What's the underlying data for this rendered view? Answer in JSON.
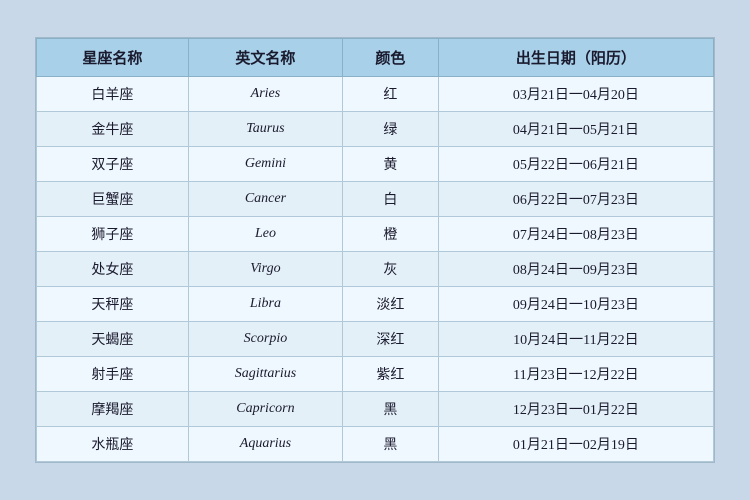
{
  "table": {
    "headers": [
      "星座名称",
      "英文名称",
      "颜色",
      "出生日期（阳历）"
    ],
    "rows": [
      {
        "zh": "白羊座",
        "en": "Aries",
        "color": "红",
        "dates": "03月21日一04月20日"
      },
      {
        "zh": "金牛座",
        "en": "Taurus",
        "color": "绿",
        "dates": "04月21日一05月21日"
      },
      {
        "zh": "双子座",
        "en": "Gemini",
        "color": "黄",
        "dates": "05月22日一06月21日"
      },
      {
        "zh": "巨蟹座",
        "en": "Cancer",
        "color": "白",
        "dates": "06月22日一07月23日"
      },
      {
        "zh": "狮子座",
        "en": "Leo",
        "color": "橙",
        "dates": "07月24日一08月23日"
      },
      {
        "zh": "处女座",
        "en": "Virgo",
        "color": "灰",
        "dates": "08月24日一09月23日"
      },
      {
        "zh": "天秤座",
        "en": "Libra",
        "color": "淡红",
        "dates": "09月24日一10月23日"
      },
      {
        "zh": "天蝎座",
        "en": "Scorpio",
        "color": "深红",
        "dates": "10月24日一11月22日"
      },
      {
        "zh": "射手座",
        "en": "Sagittarius",
        "color": "紫红",
        "dates": "11月23日一12月22日"
      },
      {
        "zh": "摩羯座",
        "en": "Capricorn",
        "color": "黑",
        "dates": "12月23日一01月22日"
      },
      {
        "zh": "水瓶座",
        "en": "Aquarius",
        "color": "黑",
        "dates": "01月21日一02月19日"
      }
    ]
  }
}
